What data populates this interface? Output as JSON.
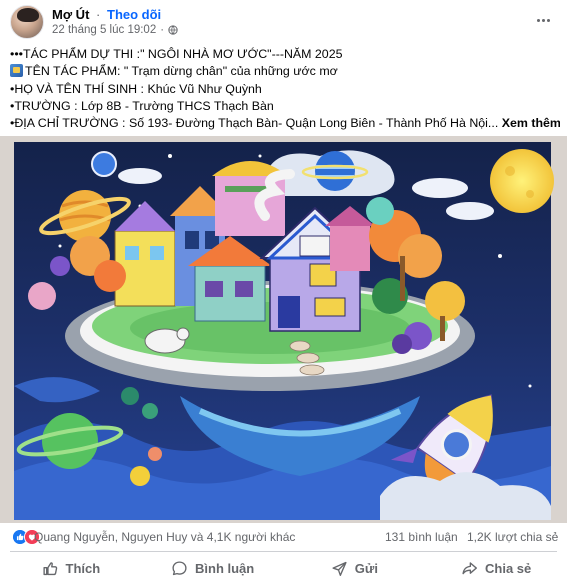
{
  "post": {
    "author": "Mợ Út",
    "separator": "·",
    "follow_label": "Theo dõi",
    "timestamp": "22 tháng 5 lúc 19:02",
    "separator2": "·"
  },
  "caption": {
    "line1": "•••TÁC PHẨM DỰ THI :\" NGÔI NHÀ MƠ ƯỚC\"---NĂM 2025",
    "line2": "TÊN TÁC PHẨM: \" Trạm dừng chân\" của những ước mơ",
    "line3": "•HỌ VÀ TÊN THÍ SINH : Khúc Vũ Như Quỳnh",
    "line4": "•TRƯỜNG : Lớp 8B - Trường THCS Thạch Bàn",
    "line5": "•ĐỊA CHỈ TRƯỜNG : Số 193- Đường Thạch Bàn- Quận Long Biên - Thành Phố Hà Nội...",
    "see_more": "Xem thêm"
  },
  "stats": {
    "reactors": "Quang Nguyễn, Nguyen Huy và 4,1K người khác",
    "comments": "131 bình luận",
    "shares": "1,2K lượt chia sẻ"
  },
  "actions": {
    "like": "Thích",
    "comment": "Bình luận",
    "send": "Gửi",
    "share": "Chia sẻ"
  },
  "icons": {
    "more": "more-horizontal-icon",
    "privacy": "globe-icon",
    "like_reaction": "like-reaction-icon",
    "love_reaction": "love-reaction-icon",
    "like": "thumbs-up-icon",
    "comment": "comment-bubble-icon",
    "send": "send-icon",
    "share": "share-arrow-icon",
    "caption_emoji": "framed-picture-emoji"
  },
  "colors": {
    "brand": "#0866ff",
    "text_primary": "#050505",
    "text_secondary": "#65676b",
    "like_blue": "#1877f2",
    "love_red": "#f33e58"
  }
}
